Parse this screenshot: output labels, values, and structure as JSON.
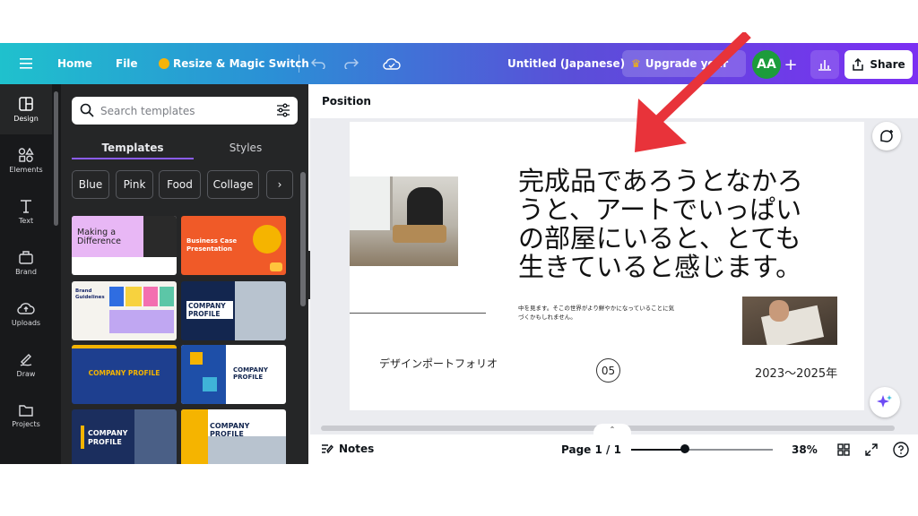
{
  "topbar": {
    "menu_icon": "hamburger-menu-icon",
    "home_label": "Home",
    "file_label": "File",
    "resize_label": "Resize & Magic Switch",
    "doc_title": "Untitled (Japanese)",
    "upgrade_label": "Upgrade your",
    "avatar_initials": "AA",
    "share_label": "Share"
  },
  "rail": {
    "items": [
      {
        "label": "Design",
        "icon": "design-icon"
      },
      {
        "label": "Elements",
        "icon": "elements-icon"
      },
      {
        "label": "Text",
        "icon": "text-icon"
      },
      {
        "label": "Brand",
        "icon": "brand-icon"
      },
      {
        "label": "Uploads",
        "icon": "uploads-icon"
      },
      {
        "label": "Draw",
        "icon": "draw-icon"
      },
      {
        "label": "Projects",
        "icon": "projects-icon"
      }
    ]
  },
  "panel": {
    "search_placeholder": "Search templates",
    "tabs": [
      "Templates",
      "Styles"
    ],
    "chips": [
      "Blue",
      "Pink",
      "Food",
      "Collage"
    ],
    "templates": [
      {
        "title": "Making a Difference"
      },
      {
        "title": "Business Case Presentation"
      },
      {
        "title": "Brand Guidelines"
      },
      {
        "title": "COMPANY PROFILE"
      },
      {
        "title": "COMPANY PROFILE"
      },
      {
        "title": "COMPANY PROFILE"
      },
      {
        "title": "COMPANY PROFILE"
      },
      {
        "title": "COMPANY PROFILE"
      }
    ]
  },
  "workspace": {
    "header_label": "Position"
  },
  "slide": {
    "headline": "完成品であろうとなかろうと、アートでいっぱいの部屋にいると、とても生きていると感じます。",
    "small_text": "中を見ます。そこの世界がより鮮やかになっていることに気づくかもしれません。",
    "portfolio_label": "デザインポートフォリオ",
    "page_badge": "05",
    "years": "2023〜2025年"
  },
  "footer": {
    "notes_label": "Notes",
    "page_label": "Page 1 / 1",
    "zoom_label": "38%",
    "zoom_fraction": 0.38
  },
  "colors": {
    "accent": "#8b5cf6",
    "avatar_bg": "#1c9c3b",
    "arrow": "#e8333a"
  }
}
